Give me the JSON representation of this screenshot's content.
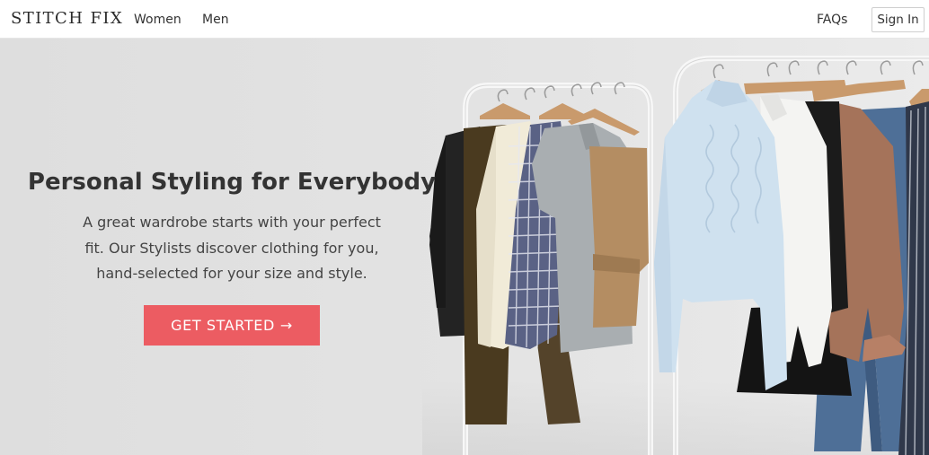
{
  "header": {
    "logo": "STITCH FIX",
    "nav": {
      "women": "Women",
      "men": "Men",
      "faqs": "FAQs"
    },
    "sign_in": "Sign In"
  },
  "hero": {
    "title": "Personal Styling for Everybody",
    "text": "A great wardrobe starts with your perfect fit. Our Stylists discover clothing for you, hand-selected for your size and style.",
    "cta": "GET STARTED",
    "cta_icon": "arrow-right-icon"
  },
  "colors": {
    "accent": "#ec5c62",
    "background": "#e2e2e2",
    "text": "#333333"
  }
}
